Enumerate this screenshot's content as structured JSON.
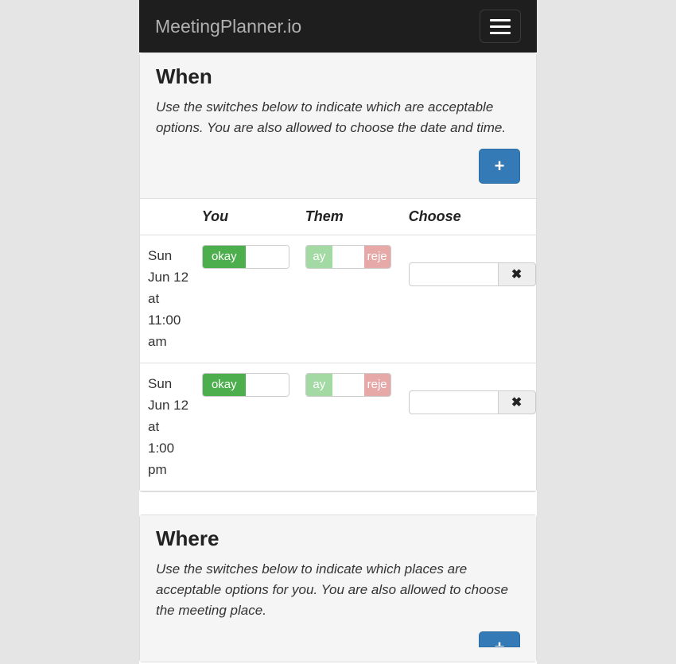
{
  "navbar": {
    "brand": "MeetingPlanner.io"
  },
  "when": {
    "title": "When",
    "desc": "Use the switches below to indicate which are acceptable options.  You are also allowed to choose the date and time.",
    "add_label": "+",
    "columns": {
      "time": "",
      "you": "You",
      "them": "Them",
      "choose": "Choose"
    },
    "rows": [
      {
        "time": "Sun Jun 12 at 11:00 am",
        "you_label": "okay",
        "them_left": "ay",
        "them_right": "reje"
      },
      {
        "time": "Sun Jun 12 at 1:00 pm",
        "you_label": "okay",
        "them_left": "ay",
        "them_right": "reje"
      }
    ]
  },
  "where": {
    "title": "Where",
    "desc": "Use the switches below to indicate which places are acceptable options for you.  You are also allowed to choose the meeting place.",
    "add_label": "+"
  },
  "icons": {
    "close": "✖"
  }
}
